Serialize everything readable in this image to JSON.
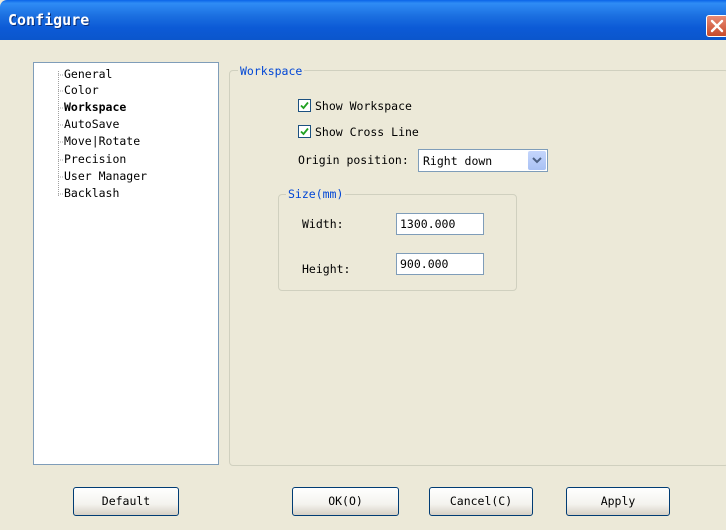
{
  "window": {
    "title": "Configure"
  },
  "tree": {
    "items": [
      {
        "label": "General",
        "selected": false
      },
      {
        "label": "Color",
        "selected": false
      },
      {
        "label": "Workspace",
        "selected": true
      },
      {
        "label": "AutoSave",
        "selected": false
      },
      {
        "label": "Move|Rotate",
        "selected": false
      },
      {
        "label": "Precision",
        "selected": false
      },
      {
        "label": "User Manager",
        "selected": false
      },
      {
        "label": "Backlash",
        "selected": false
      }
    ]
  },
  "workspace": {
    "title": "Workspace",
    "show_workspace": {
      "label": "Show Workspace",
      "checked": true
    },
    "show_cross_line": {
      "label": "Show Cross Line",
      "checked": true
    },
    "origin": {
      "label": "Origin position:",
      "value": "Right down"
    },
    "size": {
      "title": "Size(mm)",
      "width_label": "Width:",
      "width_value": "1300.000",
      "height_label": "Height:",
      "height_value": "900.000"
    }
  },
  "buttons": {
    "default_label": "Default",
    "ok_label": "OK(O)",
    "cancel_label": "Cancel(C)",
    "apply_label": "Apply"
  },
  "colors": {
    "titlebar": "#0b56cc",
    "face": "#ece9d8",
    "legend_text": "#0046d5",
    "checkmark": "#21a121",
    "close_button": "#c74a2a"
  }
}
